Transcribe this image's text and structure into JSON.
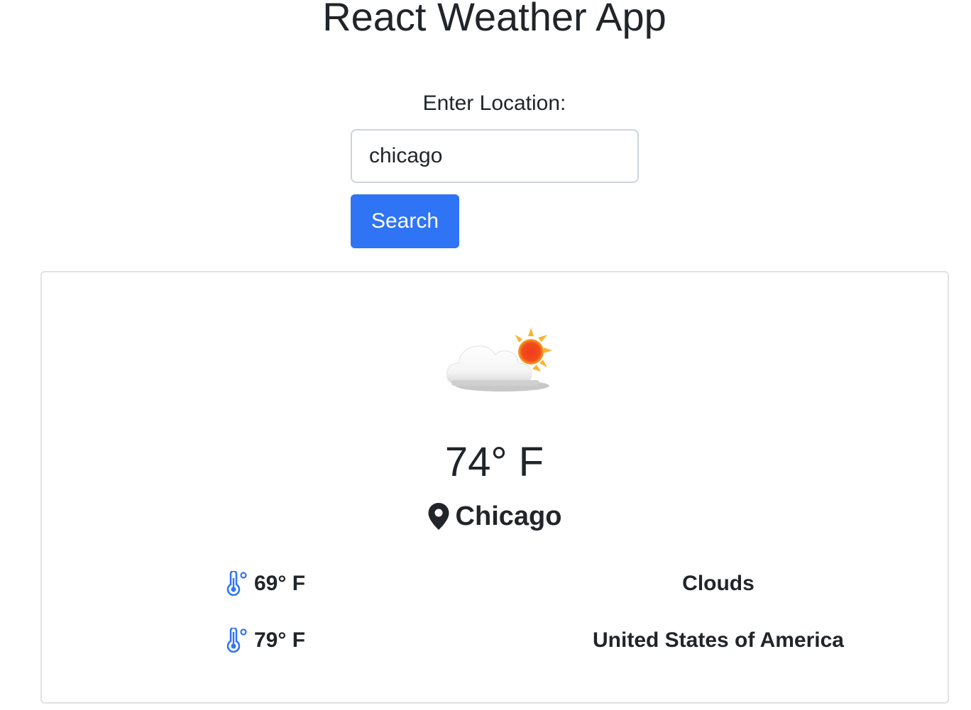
{
  "app": {
    "title": "React Weather App"
  },
  "search": {
    "label": "Enter Location:",
    "input_value": "chicago",
    "button_label": "Search"
  },
  "weather": {
    "icon": "partly-cloudy-icon",
    "temperature": "74° F",
    "city": "Chicago",
    "min_temp": "69° F",
    "max_temp": "79° F",
    "condition": "Clouds",
    "country": "United States of America"
  },
  "colors": {
    "primary": "#2f74f5",
    "text": "#212529",
    "border": "#ced4da",
    "card_border": "#dfe2e6",
    "thermometer": "#2f74f5"
  }
}
